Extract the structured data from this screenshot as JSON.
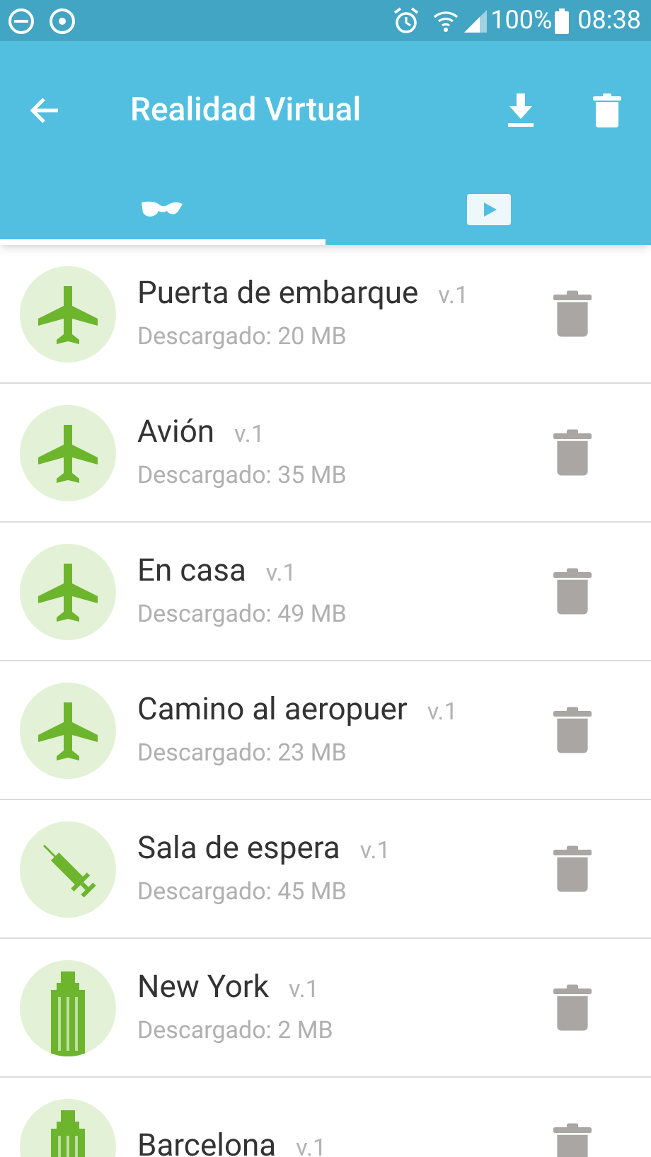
{
  "status_bar": {
    "battery": "100%",
    "time": "08:38"
  },
  "app_bar": {
    "title": "Realidad Virtual"
  },
  "tabs": [
    {
      "kind": "glasses",
      "selected": true
    },
    {
      "kind": "video",
      "selected": false
    }
  ],
  "items": [
    {
      "kind": "plane",
      "title": "Puerta de embarque",
      "version": "v.1",
      "subtitle": "Descargado: 20 MB"
    },
    {
      "kind": "plane",
      "title": "Avión",
      "version": "v.1",
      "subtitle": "Descargado: 35 MB"
    },
    {
      "kind": "plane",
      "title": "En casa",
      "version": "v.1",
      "subtitle": "Descargado: 49 MB"
    },
    {
      "kind": "plane",
      "title": "Camino al aeropuer",
      "version": "v.1",
      "subtitle": "Descargado: 23 MB"
    },
    {
      "kind": "syringe",
      "title": "Sala de espera",
      "version": "v.1",
      "subtitle": "Descargado: 45 MB"
    },
    {
      "kind": "building",
      "title": "New York",
      "version": "v.1",
      "subtitle": "Descargado: 2 MB"
    },
    {
      "kind": "building",
      "title": "Barcelona",
      "version": "v.1"
    }
  ]
}
